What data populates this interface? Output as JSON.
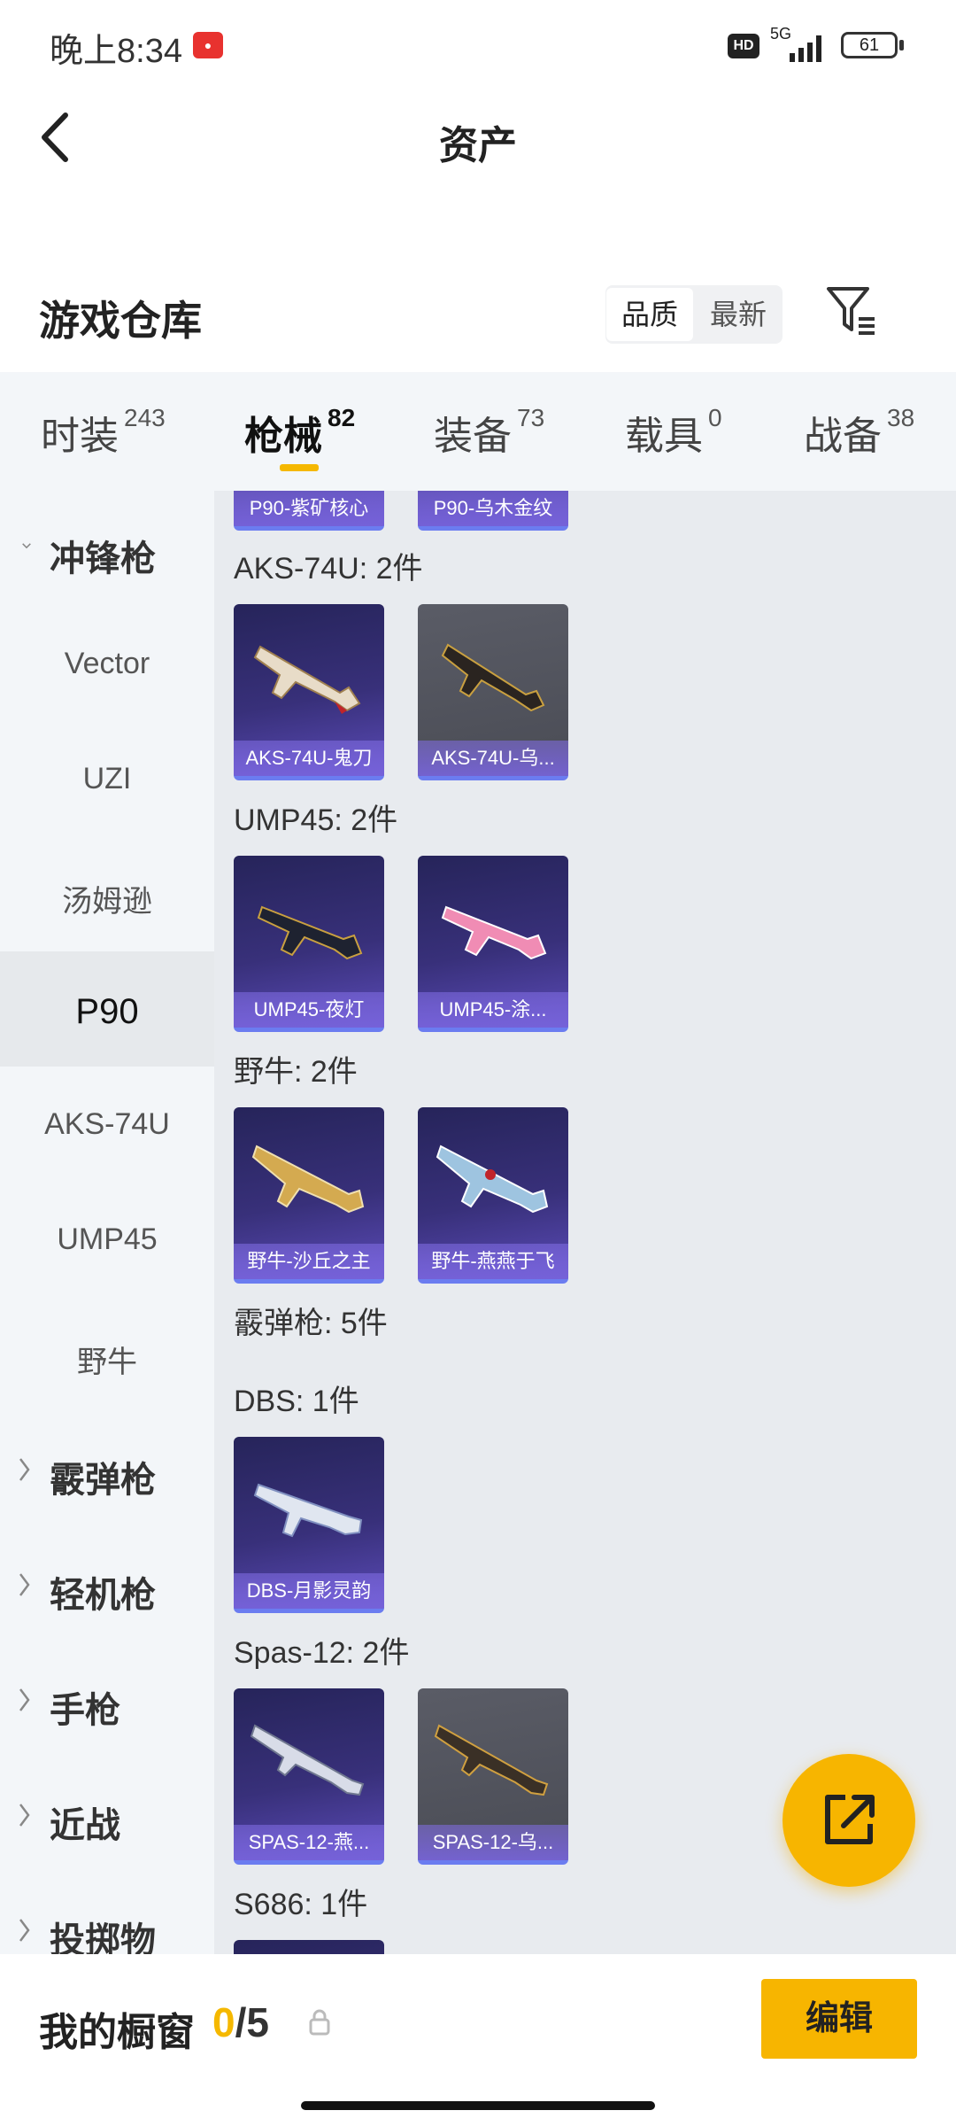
{
  "status_bar": {
    "time": "晚上8:34",
    "hd": "HD",
    "network": "5G",
    "battery": "61"
  },
  "header": {
    "title": "资产"
  },
  "warehouse": {
    "title": "游戏仓库",
    "sort_options": [
      "品质",
      "最新"
    ],
    "active_sort": "品质"
  },
  "tabs": [
    {
      "label": "时装",
      "count": "243"
    },
    {
      "label": "枪械",
      "count": "82"
    },
    {
      "label": "装备",
      "count": "73"
    },
    {
      "label": "载具",
      "count": "0"
    },
    {
      "label": "战备",
      "count": "38"
    }
  ],
  "active_tab": "枪械",
  "sidebar": {
    "category_open": "冲锋枪",
    "subitems": [
      "Vector",
      "UZI",
      "汤姆逊",
      "P90",
      "AKS-74U",
      "UMP45",
      "野牛"
    ],
    "active_item": "P90",
    "categories_closed": [
      "霰弹枪",
      "轻机枪",
      "手枪",
      "近战",
      "投掷物"
    ]
  },
  "content": {
    "top_partial_cards": [
      "P90-紫矿核心",
      "P90-乌木金纹"
    ],
    "groups": [
      {
        "header": "AKS-74U: 2件",
        "cards": [
          {
            "name": "AKS-74U-鬼刀",
            "style": "purple"
          },
          {
            "name": "AKS-74U-乌...",
            "style": "gray"
          }
        ]
      },
      {
        "header": "UMP45: 2件",
        "cards": [
          {
            "name": "UMP45-夜灯",
            "style": "purple"
          },
          {
            "name": "UMP45-涂...",
            "style": "purple"
          }
        ]
      },
      {
        "header": "野牛: 2件",
        "cards": [
          {
            "name": "野牛-沙丘之主",
            "style": "purple"
          },
          {
            "name": "野牛-燕燕于飞",
            "style": "purple"
          }
        ]
      },
      {
        "header": "霰弹枪: 5件",
        "cards": []
      },
      {
        "header": "DBS: 1件",
        "cards": [
          {
            "name": "DBS-月影灵韵",
            "style": "purple"
          }
        ]
      },
      {
        "header": "Spas-12: 2件",
        "cards": [
          {
            "name": "SPAS-12-燕...",
            "style": "purple"
          },
          {
            "name": "SPAS-12-乌...",
            "style": "gray"
          }
        ]
      },
      {
        "header": "S686: 1件",
        "cards": []
      }
    ]
  },
  "fab": {
    "icon": "share-icon"
  },
  "bottom_bar": {
    "label": "我的橱窗",
    "current": "0",
    "separator": "/",
    "total": "5",
    "edit_label": "编辑"
  },
  "colors": {
    "accent": "#f5b800",
    "card_purple": "#38307a",
    "card_gray": "#4a4c55"
  }
}
